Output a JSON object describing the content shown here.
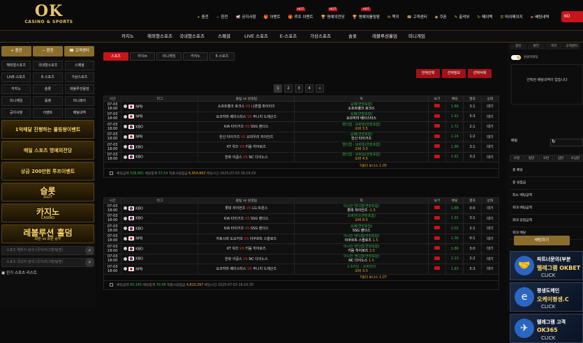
{
  "logo": {
    "main": "OK",
    "sub": "CASINO & SPORTS"
  },
  "topnav": [
    {
      "label": "충전",
      "icon": "+",
      "hot": ""
    },
    {
      "label": "환전",
      "icon": "−",
      "hot": ""
    },
    {
      "label": "공지사항",
      "icon": "📢",
      "hot": ""
    },
    {
      "label": "이벤트",
      "icon": "🎁",
      "hot": ""
    },
    {
      "label": "루프 이벤트",
      "icon": "🎁",
      "hot": "HOT"
    },
    {
      "label": "명예의전당",
      "icon": "🏆",
      "hot": "HOT"
    },
    {
      "label": "명예의롤링왕",
      "icon": "🏆",
      "hot": "HOT"
    },
    {
      "label": "쪽지",
      "icon": "✉",
      "hot": ""
    },
    {
      "label": "고객센터",
      "icon": "☎",
      "hot": ""
    },
    {
      "label": "쿠폰",
      "icon": "◉",
      "hot": ""
    },
    {
      "label": "출석부",
      "icon": "✎",
      "hot": ""
    },
    {
      "label": "페이백",
      "icon": "↻",
      "hot": ""
    },
    {
      "label": "마이페이지",
      "icon": "☰",
      "hot": ""
    },
    {
      "label": "배팅내역",
      "icon": "≡",
      "hot": ""
    }
  ],
  "lang": "KO",
  "menu": [
    "카지노",
    "해외형스포츠",
    "국내형스포츠",
    "스페셜",
    "LIVE 스포츠",
    "E-스포츠",
    "가상스포츠",
    "슬롯",
    "레볼루션홀덤",
    "미니게임"
  ],
  "left": {
    "top_buttons": [
      "+ 충전",
      "− 환전",
      "☎ 고객센터"
    ],
    "categories": [
      "해외형스포츠",
      "국내형스포츠",
      "스페셜",
      "LIVE-스포츠",
      "E-스포츠",
      "가상스포츠",
      "카지노",
      "슬롯",
      "레볼루션홀덤",
      "미니게임",
      "룰렛",
      "미니레어",
      "공지사항",
      "이벤트",
      "배팅내역"
    ],
    "banners": [
      {
        "text": "1억매달 진행하는 롤링왕이벤트",
        "sub": ""
      },
      {
        "text": "매일 스포츠 명예의전당",
        "sub": ""
      },
      {
        "text": "상금 200만원 루프이벤트",
        "sub": ""
      },
      {
        "text": "슬롯",
        "sub": "SLOT"
      },
      {
        "text": "카지노",
        "sub": "CASINO"
      },
      {
        "text": "레볼루션 홀덤",
        "sub": "회원 vs 회원 승부"
      }
    ],
    "search1": "스포츠 해외식 검색 (국가/리그명/팀명)",
    "search2": "스포츠 국내식 검색 (국가/리그명/팀명)",
    "live_list": "인기 스포츠 리스트"
  },
  "main": {
    "tabs": [
      "스포츠",
      "라이브",
      "미니게임",
      "카지노",
      "E-스포츠"
    ],
    "actions": [
      "전체선택",
      "선택정보",
      "선택삭제"
    ],
    "pages": [
      "1",
      "2",
      "3",
      "4",
      "»"
    ],
    "headers": [
      "시간",
      "리그",
      "홈팀 vs 원정팀",
      "픽",
      "보기",
      "배당",
      "결과",
      "상태"
    ],
    "table1": [
      {
        "time": "07-03\n18:00",
        "flag": "jp",
        "league": "NPB",
        "home": "소프트뱅크 호크스",
        "away": "니혼햄 파이터즈",
        "pick1": "승패(연장포함)",
        "pick2": "소프트뱅크 호크스",
        "pick3": "",
        "odd": "1.88",
        "res": "3:1",
        "status": "대기"
      },
      {
        "time": "07-03\n18:00",
        "flag": "jp",
        "league": "NPB",
        "home": "요코하마 베이스타스",
        "away": "주니치 드래곤즈",
        "pick1": "승패(연장포함)",
        "pick2": "요코하마 베이스타스",
        "pick3": "",
        "odd": "1.91",
        "res": "5:3",
        "status": "대기"
      },
      {
        "time": "07-03\n18:00",
        "flag": "kr",
        "league": "KBO",
        "home": "KIA 타이거즈",
        "away": "SSG 랜더스",
        "pick1": "핸디캡 - 모바일(연장포함)",
        "pick2": "",
        "pick3": "오버 3.5",
        "odd": "1.72",
        "res": "2:1",
        "status": "대기"
      },
      {
        "time": "07-03\n18:00",
        "flag": "jp",
        "league": "NPB",
        "home": "한신 타이거즈",
        "away": "요미우리 자이언츠",
        "pick1": "승패(연장포함)",
        "pick2": "한신 타이거즈",
        "pick3": "",
        "odd": "2.24",
        "res": "1:2",
        "status": "대기"
      },
      {
        "time": "07-03\n18:00",
        "flag": "kr",
        "league": "KBO",
        "home": "KT 위즈",
        "away": "키움 히어로즈",
        "pick1": "핸디캡 - 모바일(연장포함)",
        "pick2": "",
        "pick3": "오버 3.5",
        "odd": "1.88",
        "res": "3:1",
        "status": "대기"
      },
      {
        "time": "07-03\n18:00",
        "flag": "kr",
        "league": "KBO",
        "home": "한화 이글스",
        "away": "NC 다이노스",
        "pick1": "핸디캡 - 모바일(연장포함)",
        "pick2": "",
        "pick3": "오버 4.5",
        "odd": "1.91",
        "res": "3:2",
        "status": "대기"
      }
    ],
    "summary1": "5폴더 보너스 1.05",
    "footer1": {
      "label1": "배팅금액",
      "v1": "528,881",
      "label2": "배당합계",
      "v2": "53.54",
      "label3": "적중시당첨금",
      "v3": "6,954,863",
      "label4": "배팅시간",
      "v4": "2025-07-03 16:19:29"
    },
    "table2": [
      {
        "time": "07-03\n18:00",
        "flag": "kr",
        "league": "KBO",
        "home": "롯데 자이언츠",
        "away": "LG 트윈스",
        "pick1": "아시안 핸디캡(연장포함)",
        "pick2": "롯데 자이언츠",
        "pick3": "-1.5",
        "odd": "1.88",
        "res": "0:0",
        "status": "대기"
      },
      {
        "time": "07-03\n18:00",
        "flag": "kr",
        "league": "KBO",
        "home": "KIA 타이거즈",
        "away": "SSG 랜더스",
        "pick1": "오버언더(연장포함)",
        "pick2": "",
        "pick3": "오버 8.5",
        "odd": "1.91",
        "res": "3:1",
        "status": "대기"
      },
      {
        "time": "07-03\n18:00",
        "flag": "kr",
        "league": "KBO",
        "home": "KIA 타이거즈",
        "away": "SSG 랜더스",
        "pick1": "승패(연장포함)",
        "pick2": "SSG 랜더스",
        "pick3": "",
        "odd": "2.02",
        "res": "2:1",
        "status": "대기"
      },
      {
        "time": "07-03\n18:00",
        "flag": "jp",
        "league": "NPB",
        "home": "히로시마 도요카프",
        "away": "야쿠르트 스왈로즈",
        "pick1": "아시안 핸디캡(연장포함)",
        "pick2": "야쿠르트 스왈로즈",
        "pick3": "1.5",
        "odd": "1.36",
        "res": "0:1",
        "status": "대기"
      },
      {
        "time": "07-03\n18:00",
        "flag": "kr",
        "league": "KBO",
        "home": "KT 위즈",
        "away": "키움 히어로즈",
        "pick1": "아시안 핸디캡(연장포함)",
        "pick2": "키움 히어로즈",
        "pick3": "2.5",
        "odd": "1.86",
        "res": "3:0",
        "status": "대기"
      },
      {
        "time": "07-03\n18:00",
        "flag": "kr",
        "league": "KBO",
        "home": "한화 이글스",
        "away": "NC 다이노스",
        "pick1": "아시안 핸디캡(연장포함)",
        "pick2": "NC 다이노스",
        "pick3": "1.5",
        "odd": "2.23",
        "res": "2:2",
        "status": "대기"
      },
      {
        "time": "07-03\n18:00",
        "flag": "jp",
        "league": "NPB",
        "home": "요코하마 베이스타스",
        "away": "주니치 드래곤즈",
        "pick1": "1-5이닝 - 오버언더",
        "pick2": "",
        "pick3": "오버 3.5",
        "odd": "1.83",
        "res": "5:3",
        "status": "대기"
      }
    ],
    "summary2": "7폴더 보너스 1.07",
    "footer2": {
      "label1": "배팅금액",
      "v1": "60,145",
      "label2": "배당합계",
      "v2": "79.98",
      "label3": "적중시당첨금",
      "v3": "4,810,397",
      "label4": "배팅시간",
      "v4": "2025-07-03 16:10:35"
    }
  },
  "right": {
    "tabs": [
      "충전",
      "환전",
      "쪽지",
      "고객센터"
    ],
    "toggle_label": "원클릭배팅",
    "empty_msg": "선택된 배팅내역이 없습니다",
    "bet_label": "배팅",
    "chips": [
      "오천",
      "일만",
      "오만",
      "십만",
      "오십만"
    ],
    "rows": [
      "총 배당",
      "총 당첨금",
      "최소 배팅금액",
      "최대 배팅금액",
      "최대 당첨금액",
      "최대 배당"
    ],
    "bet_button": "배팅하기",
    "banners": [
      {
        "t": "파트너문의(부분",
        "t2": "텔레그램 OKBET",
        "t3": "CLICK",
        "icon": "🤝"
      },
      {
        "t": "평생도메인",
        "t2": "오케이평생.C",
        "t3": "CLICK",
        "icon": "e"
      },
      {
        "t": "텔레그램 고객",
        "t2": "OK365",
        "t3": "CLICK",
        "icon": "✈"
      }
    ]
  }
}
